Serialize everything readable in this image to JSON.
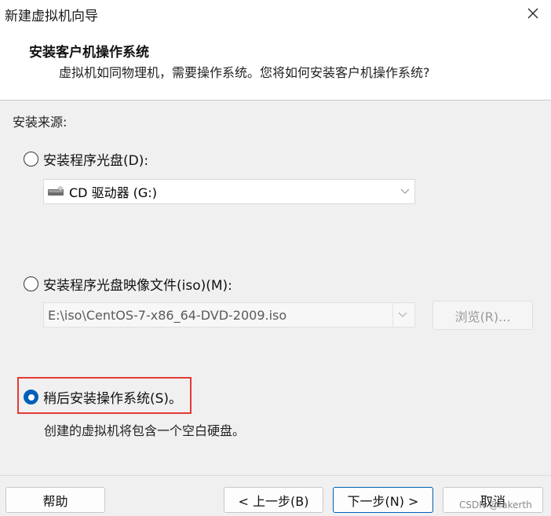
{
  "window": {
    "title": "新建虚拟机向导",
    "close_icon": "close-icon"
  },
  "header": {
    "title": "安装客户机操作系统",
    "subtitle": "虚拟机如同物理机，需要操作系统。您将如何安装客户机操作系统?"
  },
  "source": {
    "label": "安装来源:",
    "options": [
      {
        "label": "安装程序光盘(D):",
        "checked": false
      },
      {
        "label": "安装程序光盘映像文件(iso)(M):",
        "checked": false
      },
      {
        "label": "稍后安装操作系统(S)。",
        "checked": true,
        "description": "创建的虚拟机将包含一个空白硬盘。"
      }
    ],
    "disc_drive": {
      "value": "CD 驱动器 (G:)",
      "icon": "cd-drive-icon"
    },
    "iso_path": {
      "value": "E:\\iso\\CentOS-7-x86_64-DVD-2009.iso"
    },
    "browse_label": "浏览(R)..."
  },
  "footer": {
    "help": "帮助",
    "back": "< 上一步(B)",
    "next": "下一步(N) >",
    "cancel": "取消"
  },
  "watermark": "CSDN @fakerth",
  "colors": {
    "accent": "#005fb8",
    "highlight": "#e53935"
  }
}
